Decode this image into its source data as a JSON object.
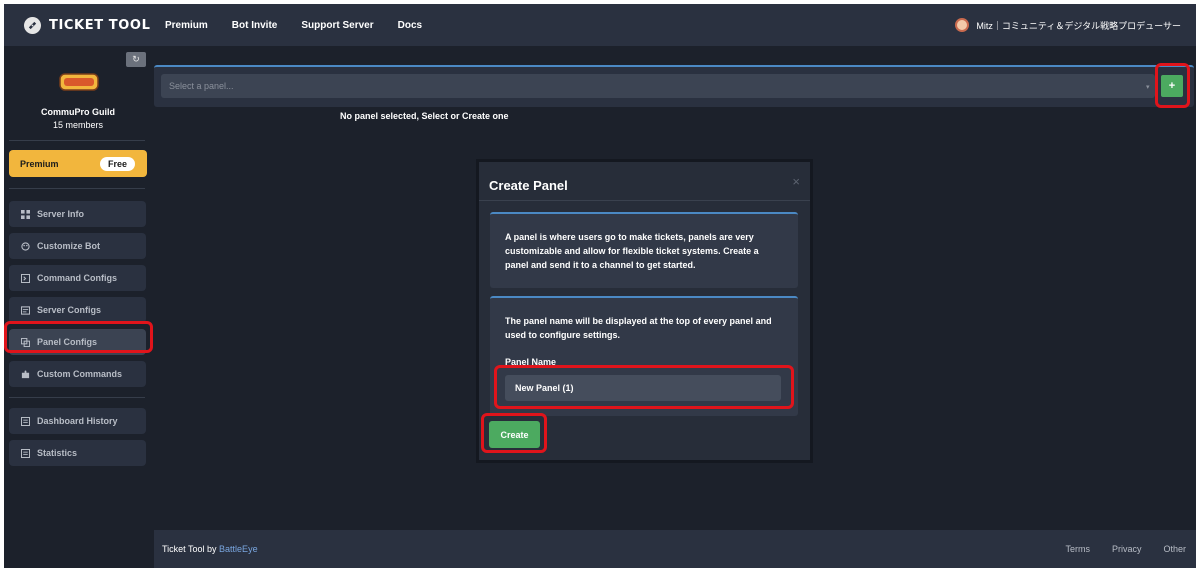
{
  "nav": {
    "brand": "TICKET TOOL",
    "links": [
      "Premium",
      "Bot Invite",
      "Support Server",
      "Docs"
    ],
    "user_name": "Mitz｜コミュニティ＆デジタル戦略プロデューサー"
  },
  "sidebar": {
    "guild_name": "CommuPro Guild",
    "guild_members": "15 members",
    "guild_logo_text": "CommuPro Guild",
    "premium_label": "Premium",
    "premium_badge": "Free",
    "items": [
      {
        "label": "Server Info",
        "icon": "grid-icon"
      },
      {
        "label": "Customize Bot",
        "icon": "palette-icon"
      },
      {
        "label": "Command Configs",
        "icon": "terminal-icon"
      },
      {
        "label": "Server Configs",
        "icon": "server-icon"
      },
      {
        "label": "Panel Configs",
        "icon": "copy-icon",
        "active": true
      },
      {
        "label": "Custom Commands",
        "icon": "puzzle-icon"
      },
      {
        "label": "Dashboard History",
        "icon": "history-icon"
      },
      {
        "label": "Statistics",
        "icon": "stats-icon"
      }
    ]
  },
  "main": {
    "select_placeholder": "Select a panel...",
    "add_label": "+",
    "empty_message": "No panel selected, Select or Create one"
  },
  "modal": {
    "title": "Create Panel",
    "close": "×",
    "intro": "A panel is where users go to make tickets, panels are very customizable and allow for flexible ticket systems. Create a panel and send it to a channel to get started.",
    "name_help": "The panel name will be displayed at the top of every panel and used to configure settings.",
    "name_label": "Panel Name",
    "name_value": "New Panel (1)",
    "create_label": "Create"
  },
  "footer": {
    "by_text": "Ticket Tool by",
    "by_link": "BattleEye",
    "links": [
      "Terms",
      "Privacy",
      "Other"
    ]
  },
  "colors": {
    "accent_green": "#4caa60",
    "premium_gold": "#f2b63d",
    "highlight_red": "#e0141b",
    "accent_blue": "#4b89c4"
  }
}
